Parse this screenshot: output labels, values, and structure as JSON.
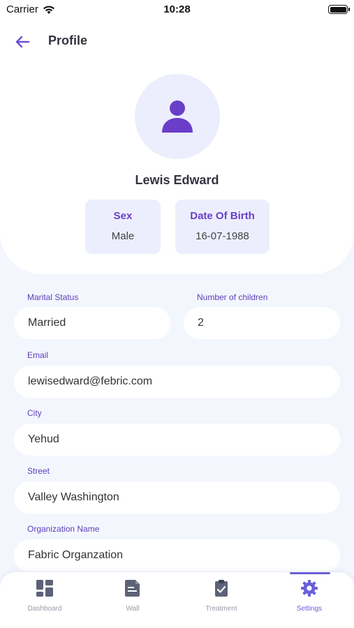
{
  "status_bar": {
    "carrier": "Carrier",
    "time": "10:28"
  },
  "header": {
    "title": "Profile"
  },
  "profile": {
    "name": "Lewis Edward",
    "sex_label": "Sex",
    "sex_value": "Male",
    "dob_label": "Date Of Birth",
    "dob_value": "16-07-1988"
  },
  "form": {
    "marital_status": {
      "label": "Marital Status",
      "value": "Married"
    },
    "children": {
      "label": "Number of children",
      "value": "2"
    },
    "email": {
      "label": "Email",
      "value": "lewisedward@febric.com"
    },
    "city": {
      "label": "City",
      "value": "Yehud"
    },
    "street": {
      "label": "Street",
      "value": "Valley Washington"
    },
    "organization": {
      "label": "Organization Name",
      "value": "Fabric Organzation"
    }
  },
  "nav": {
    "items": [
      {
        "label": "Dashboard",
        "icon": "dashboard-icon"
      },
      {
        "label": "Wall",
        "icon": "wall-icon"
      },
      {
        "label": "Treatment",
        "icon": "treatment-icon"
      },
      {
        "label": "Settings",
        "icon": "gear-icon"
      }
    ],
    "active_index": 3
  },
  "colors": {
    "accent": "#6a3ec8",
    "active_nav": "#6a5fd8",
    "inactive_nav": "#9a9aa8",
    "background": "#f4f6fe"
  }
}
